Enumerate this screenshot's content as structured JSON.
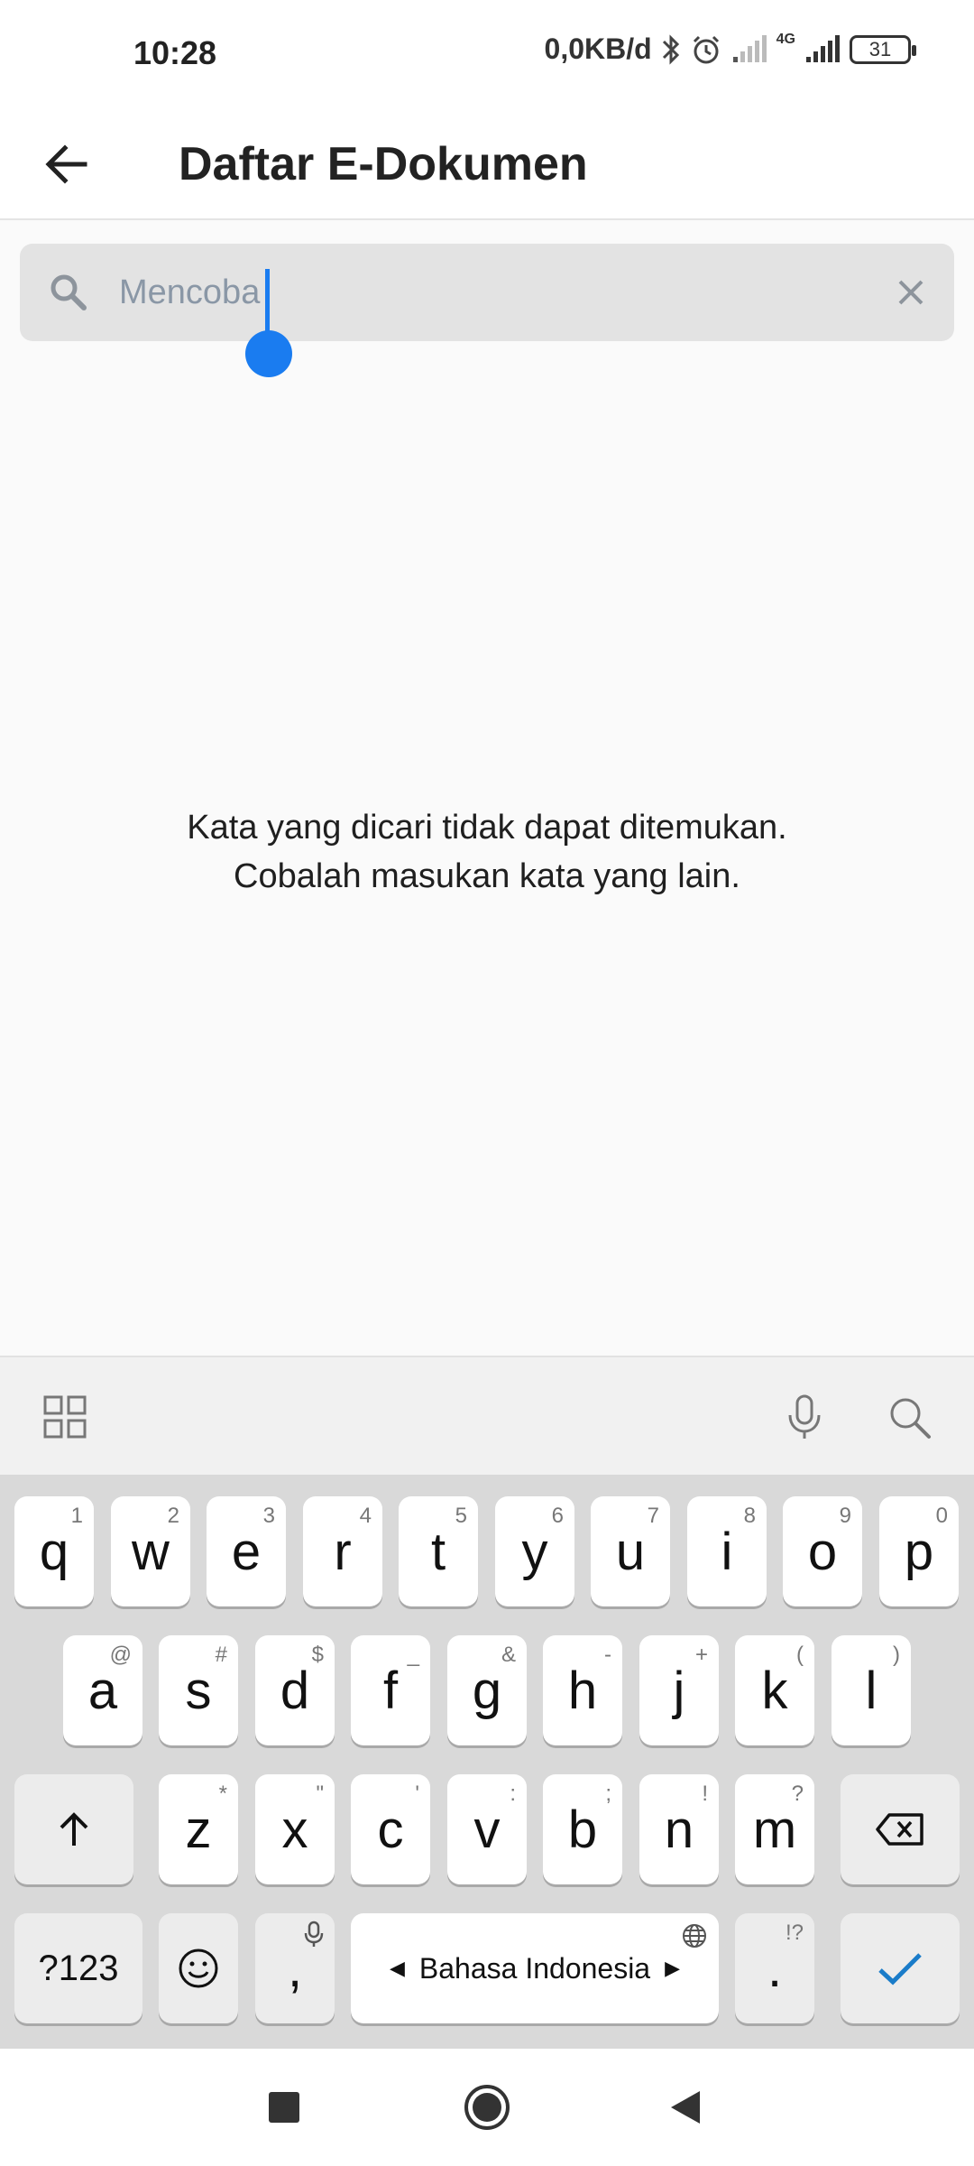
{
  "status_bar": {
    "time": "10:28",
    "net_speed": "0,0KB/d",
    "network": "4G",
    "battery": "31"
  },
  "app_bar": {
    "title": "Daftar E-Dokumen"
  },
  "search": {
    "value": "Mencoba"
  },
  "empty_state": {
    "line1": "Kata yang dicari tidak dapat ditemukan.",
    "line2": "Cobalah masukan kata yang lain."
  },
  "keyboard": {
    "row1": [
      {
        "key": "q",
        "hint": "1"
      },
      {
        "key": "w",
        "hint": "2"
      },
      {
        "key": "e",
        "hint": "3"
      },
      {
        "key": "r",
        "hint": "4"
      },
      {
        "key": "t",
        "hint": "5"
      },
      {
        "key": "y",
        "hint": "6"
      },
      {
        "key": "u",
        "hint": "7"
      },
      {
        "key": "i",
        "hint": "8"
      },
      {
        "key": "o",
        "hint": "9"
      },
      {
        "key": "p",
        "hint": "0"
      }
    ],
    "row2": [
      {
        "key": "a",
        "hint": "@"
      },
      {
        "key": "s",
        "hint": "#"
      },
      {
        "key": "d",
        "hint": "$"
      },
      {
        "key": "f",
        "hint": "_"
      },
      {
        "key": "g",
        "hint": "&"
      },
      {
        "key": "h",
        "hint": "-"
      },
      {
        "key": "j",
        "hint": "+"
      },
      {
        "key": "k",
        "hint": "("
      },
      {
        "key": "l",
        "hint": ")"
      }
    ],
    "row3": [
      {
        "key": "z",
        "hint": "*"
      },
      {
        "key": "x",
        "hint": "\""
      },
      {
        "key": "c",
        "hint": "'"
      },
      {
        "key": "v",
        "hint": ":"
      },
      {
        "key": "b",
        "hint": ";"
      },
      {
        "key": "n",
        "hint": "!"
      },
      {
        "key": "m",
        "hint": "?"
      }
    ],
    "symbols_label": "?123",
    "comma": ",",
    "space_label": "Bahasa Indonesia",
    "period": ".",
    "period_hint": "!?"
  }
}
